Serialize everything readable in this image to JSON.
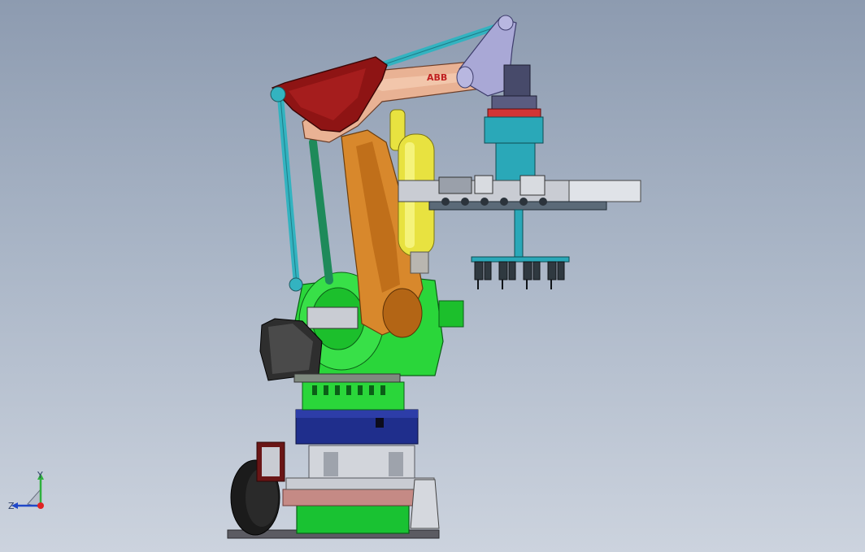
{
  "model": {
    "brand_logo": "ABB"
  },
  "triad": {
    "x_label": "Y",
    "z_label": "Z"
  },
  "colors": {
    "background_top": "#8d9bb0",
    "background_bottom": "#ccd3de",
    "base_frame_green": "#19c232",
    "base_plate_blue": "#1f2e8c",
    "turret_green": "#2ad63a",
    "lower_arm_orange": "#d8882c",
    "upper_arm_salmon": "#e9b294",
    "counterweight_red": "#8e1414",
    "tie_rod_cyan": "#33b3c0",
    "cylinder_yellow": "#e8e240",
    "wrist_lavender": "#a9a8d6",
    "gripper_teal": "#2aa8b8",
    "motor_gray": "#4a4a4a"
  }
}
